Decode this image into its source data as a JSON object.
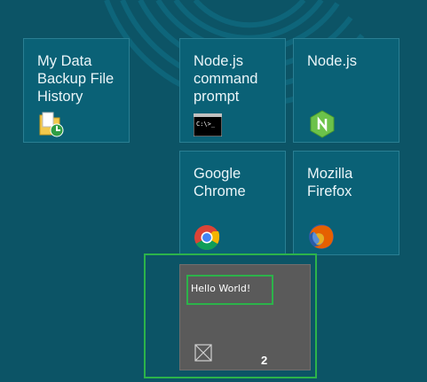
{
  "tiles": [
    {
      "label": "My Data\nBackup File\nHistory",
      "icon": "file-history-icon"
    },
    {
      "label": "Node.js\ncommand\nprompt",
      "icon": "command-prompt-icon"
    },
    {
      "label": "Node.js",
      "icon": "nodejs-icon"
    },
    {
      "label": "Google\nChrome",
      "icon": "chrome-icon"
    },
    {
      "label": "Mozilla\nFirefox",
      "icon": "firefox-icon"
    }
  ],
  "notification_tile": {
    "text": "Hello World!",
    "badge": "2",
    "icon": "broken-image-icon"
  },
  "colors": {
    "background": "#0c5466",
    "tile": "#0a6176",
    "tile_border": "#2a7f93",
    "notification_tile": "#5a5a5a",
    "highlight": "#2cb34a"
  }
}
